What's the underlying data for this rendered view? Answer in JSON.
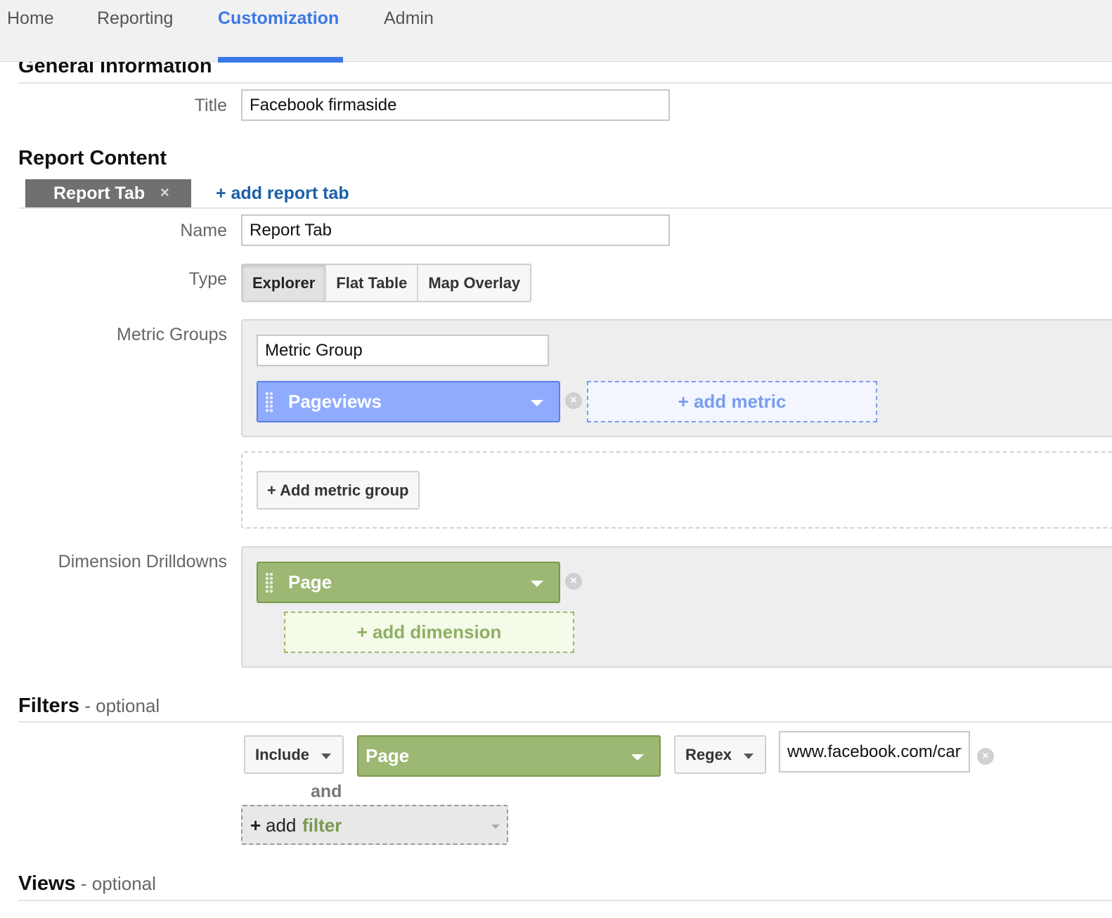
{
  "nav": {
    "items": [
      {
        "label": "Home"
      },
      {
        "label": "Reporting"
      },
      {
        "label": "Customization"
      },
      {
        "label": "Admin"
      }
    ],
    "active": "Customization",
    "accent": "#3b78e7"
  },
  "general": {
    "heading": "General Information",
    "title_label": "Title",
    "title_value": "Facebook firmaside"
  },
  "report_content": {
    "heading": "Report Content",
    "tab_label": "Report Tab",
    "tab_close": "×",
    "add_tab": "+ add report tab",
    "name_label": "Name",
    "name_value": "Report Tab",
    "type_label": "Type",
    "types": [
      "Explorer",
      "Flat Table",
      "Map Overlay"
    ],
    "type_selected": "Explorer",
    "metric_groups_label": "Metric Groups",
    "metric_group_name": "Metric Group",
    "metric": "Pageviews",
    "add_metric": "+ add metric",
    "add_metric_group": "+ Add metric group",
    "dimension_label": "Dimension Drilldowns",
    "dimension": "Page",
    "add_dimension": "+ add dimension"
  },
  "filters": {
    "heading": "Filters",
    "optional": " - optional",
    "include": "Include",
    "dimension": "Page",
    "match": "Regex",
    "value": "www.facebook.com/cart",
    "and": "and",
    "add_plus": "+",
    "add_word": "add",
    "add_key": "filter"
  },
  "views": {
    "heading": "Views",
    "optional": " - optional"
  },
  "colors": {
    "metric_blue": "#8fabfd",
    "dimension_green": "#9db872",
    "link_blue": "#1a5fa8"
  }
}
